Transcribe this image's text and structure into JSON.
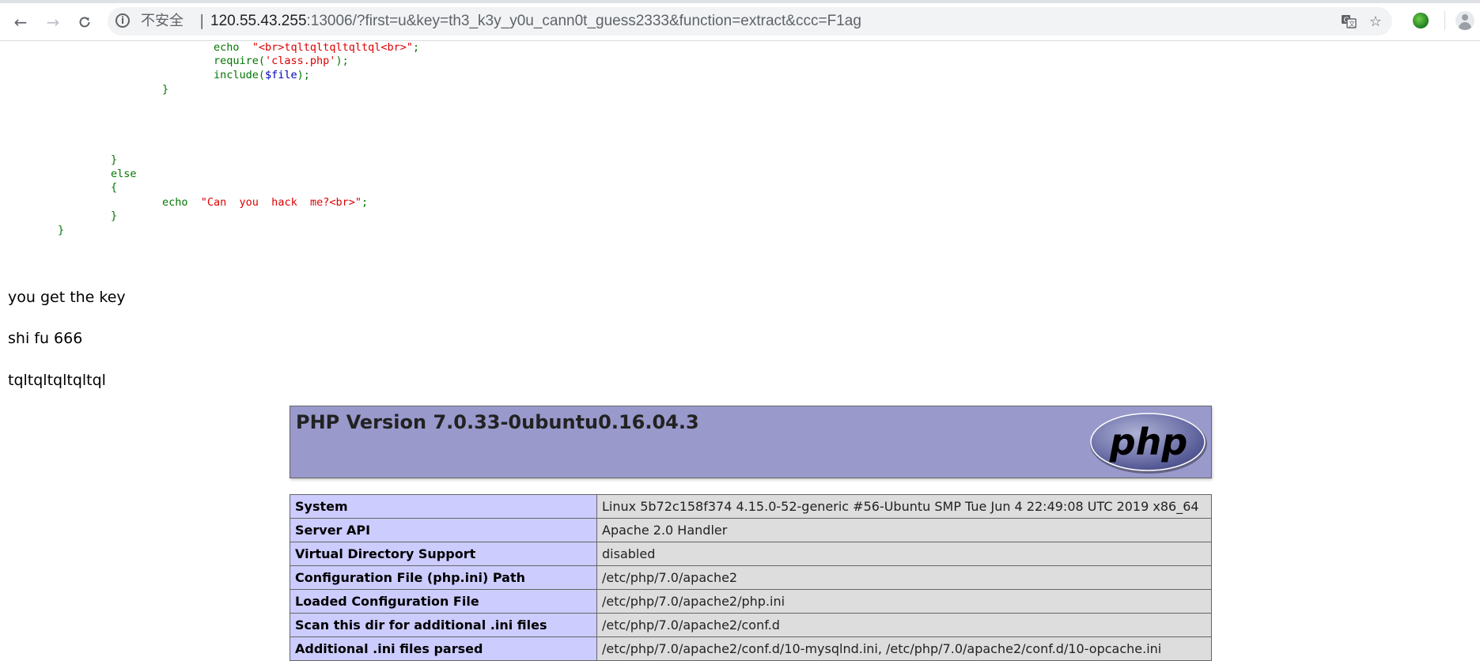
{
  "browser": {
    "security_label": "不安全",
    "separator": "|",
    "url_host": "120.55.43.255",
    "url_rest": ":13006/?first=u&key=th3_k3y_y0u_cann0t_guess2333&function=extract&ccc=F1ag",
    "icons": {
      "back": "arrow-left-icon",
      "forward": "arrow-right-icon",
      "reload": "reload-icon",
      "info": "info-icon",
      "translate": "translate-icon",
      "bookmark": "star-icon",
      "extension": "extension-icon",
      "profile": "avatar-icon"
    }
  },
  "source": {
    "line1_kw": "echo",
    "line1_str": "\"<br>tqltqltqltqltql<br>\"",
    "line1_end": ";",
    "line2_kw": "require(",
    "line2_str": "'class.php'",
    "line2_end": ");",
    "line3_kw": "include(",
    "line3_var": "$file",
    "line3_end": ");",
    "brace_close_1": "}",
    "brace_close_2": "}",
    "else_kw": "else",
    "brace_open": "{",
    "line_echo_kw": "echo",
    "line_echo_str": "\"Can  you  hack  me?<br>\"",
    "line_echo_end": ";",
    "brace_close_3": "}",
    "brace_close_4": "}"
  },
  "output": {
    "line1": "you get the key",
    "line2": "shi fu 666",
    "line3": "tqltqltqltqltql"
  },
  "phpinfo": {
    "title": "PHP Version 7.0.33-0ubuntu0.16.04.3",
    "logo_text": "php",
    "colors": {
      "header": "#9999cc",
      "key_cell": "#ccccff",
      "value_cell": "#dddddd"
    },
    "rows": [
      {
        "k": "System",
        "v": "Linux 5b72c158f374 4.15.0-52-generic #56-Ubuntu SMP Tue Jun 4 22:49:08 UTC 2019 x86_64"
      },
      {
        "k": "Server API",
        "v": "Apache 2.0 Handler"
      },
      {
        "k": "Virtual Directory Support",
        "v": "disabled"
      },
      {
        "k": "Configuration File (php.ini) Path",
        "v": "/etc/php/7.0/apache2"
      },
      {
        "k": "Loaded Configuration File",
        "v": "/etc/php/7.0/apache2/php.ini"
      },
      {
        "k": "Scan this dir for additional .ini files",
        "v": "/etc/php/7.0/apache2/conf.d"
      },
      {
        "k": "Additional .ini files parsed",
        "v": "/etc/php/7.0/apache2/conf.d/10-mysqlnd.ini, /etc/php/7.0/apache2/conf.d/10-opcache.ini"
      }
    ]
  }
}
